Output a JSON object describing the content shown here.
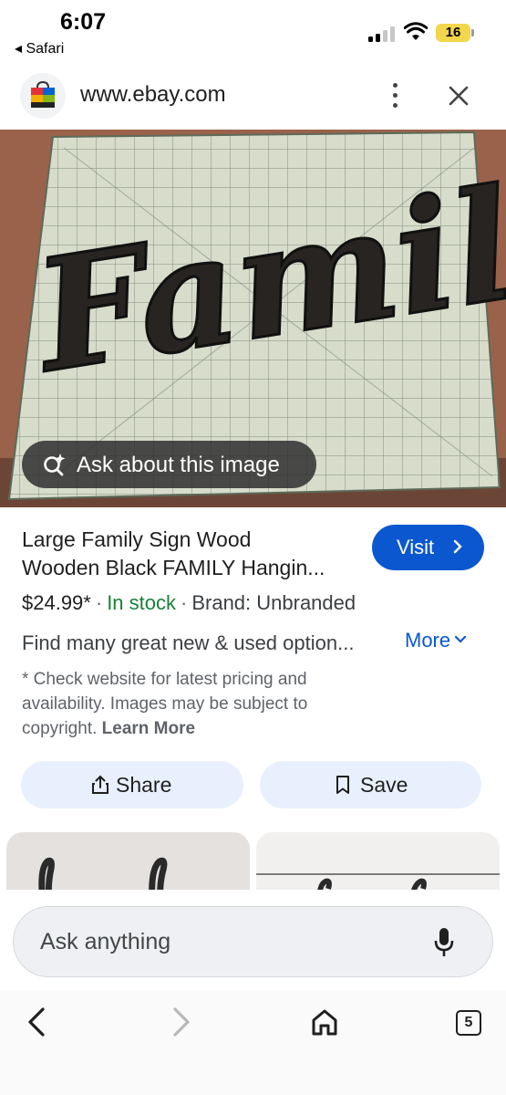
{
  "status_bar": {
    "time": "6:07",
    "back_app": "◂ Safari",
    "battery": "16"
  },
  "url_bar": {
    "url": "www.ebay.com",
    "icons": [
      "ebay-bag-icon",
      "more-vert-icon",
      "close-icon"
    ]
  },
  "hero": {
    "ask_label": "Ask about this image",
    "ask_icon": "lens-sparkle-icon"
  },
  "product": {
    "title_line1": "Large Family Sign Wood",
    "title_line2": "Wooden Black FAMILY Hangin...",
    "visit_label": "Visit",
    "price": "$24.99*",
    "sep": "·",
    "stock": "In stock",
    "brand": "Brand: Unbranded",
    "description": "Find many great new & used option...",
    "more_label": "More",
    "note_line1": "* Check website for latest pricing and",
    "note_line2": "availability. Images may be subject to",
    "note_line3_prefix": "copyright.",
    "learn_more": "Learn More"
  },
  "actions": {
    "share_label": "Share",
    "save_label": "Save"
  },
  "ask_bar": {
    "placeholder": "Ask anything",
    "mic_icon": "mic-icon"
  },
  "toolbar": {
    "tabs_count": "5",
    "icons": [
      "back-icon",
      "forward-icon",
      "home-icon",
      "tabs-icon"
    ]
  },
  "colors": {
    "accent": "#0b57d0",
    "stock_green": "#188038",
    "pill_bg": "#e8f0fe"
  }
}
